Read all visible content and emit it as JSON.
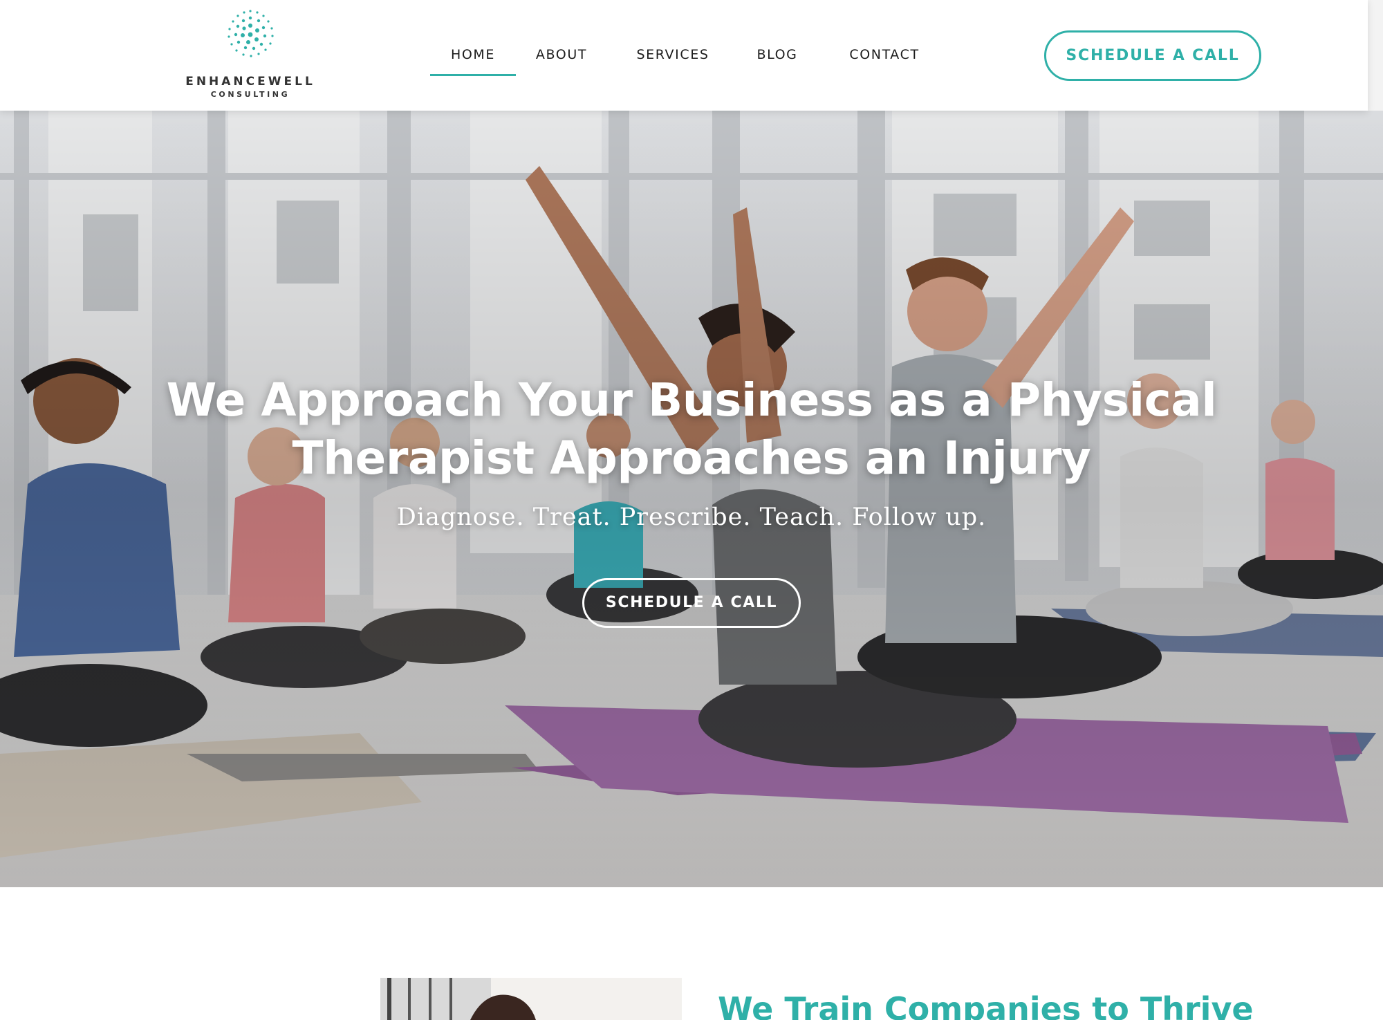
{
  "brand": {
    "name": "ENHANCEWELL",
    "tagline": "CONSULTING",
    "logo_icon": "dotted-circle-icon",
    "accent_color": "#2fb0a8"
  },
  "nav": {
    "items": [
      {
        "label": "HOME",
        "active": true
      },
      {
        "label": "ABOUT",
        "active": false
      },
      {
        "label": "SERVICES",
        "active": false
      },
      {
        "label": "BLOG",
        "active": false
      },
      {
        "label": "CONTACT",
        "active": false
      }
    ],
    "cta_label": "SCHEDULE A CALL"
  },
  "hero": {
    "title": "We Approach Your Business as a Physical Therapist Approaches an Injury",
    "subtitle": "Diagnose. Treat. Prescribe. Teach. Follow up.",
    "cta_label": "SCHEDULE A CALL",
    "background": "group yoga class in bright studio"
  },
  "intro": {
    "heading": "We Train Companies to Thrive"
  }
}
